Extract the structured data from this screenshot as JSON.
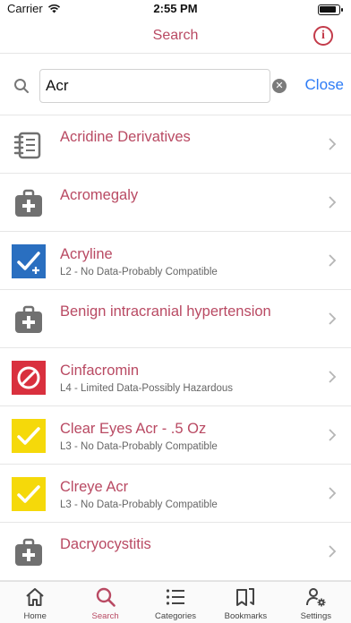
{
  "status_bar": {
    "carrier": "Carrier",
    "time": "2:55 PM"
  },
  "nav": {
    "title": "Search",
    "info_icon": "info-icon"
  },
  "search": {
    "value": "Acr",
    "placeholder": "",
    "close_label": "Close"
  },
  "colors": {
    "accent": "#b94a63",
    "link": "#2e7cf6",
    "l2_blue": "#2a6fc0",
    "l4_red": "#d9303e",
    "l3_yellow": "#f5d90a",
    "icon_gray": "#707070"
  },
  "results": [
    {
      "title": "Acridine Derivatives",
      "subtitle": "",
      "icon": "notepad-list-icon"
    },
    {
      "title": "Acromegaly",
      "subtitle": "",
      "icon": "medical-kit-icon"
    },
    {
      "title": "Acryline",
      "subtitle": "L2 - No Data-Probably Compatible",
      "icon": "check-plus-blue-icon"
    },
    {
      "title": "Benign intracranial hypertension",
      "subtitle": "",
      "icon": "medical-kit-icon"
    },
    {
      "title": "Cinfacromin",
      "subtitle": "L4 - Limited Data-Possibly Hazardous",
      "icon": "prohibited-red-icon"
    },
    {
      "title": "Clear Eyes Acr - .5 Oz",
      "subtitle": "L3 - No Data-Probably Compatible",
      "icon": "check-yellow-icon"
    },
    {
      "title": "Clreye Acr",
      "subtitle": "L3 - No Data-Probably Compatible",
      "icon": "check-yellow-icon"
    },
    {
      "title": "Dacryocystitis",
      "subtitle": "",
      "icon": "medical-kit-icon"
    }
  ],
  "tabs": [
    {
      "label": "Home",
      "icon": "home-icon",
      "active": false
    },
    {
      "label": "Search",
      "icon": "search-icon",
      "active": true
    },
    {
      "label": "Categories",
      "icon": "list-icon",
      "active": false
    },
    {
      "label": "Bookmarks",
      "icon": "bookmark-icon",
      "active": false
    },
    {
      "label": "Settings",
      "icon": "user-gear-icon",
      "active": false
    }
  ]
}
